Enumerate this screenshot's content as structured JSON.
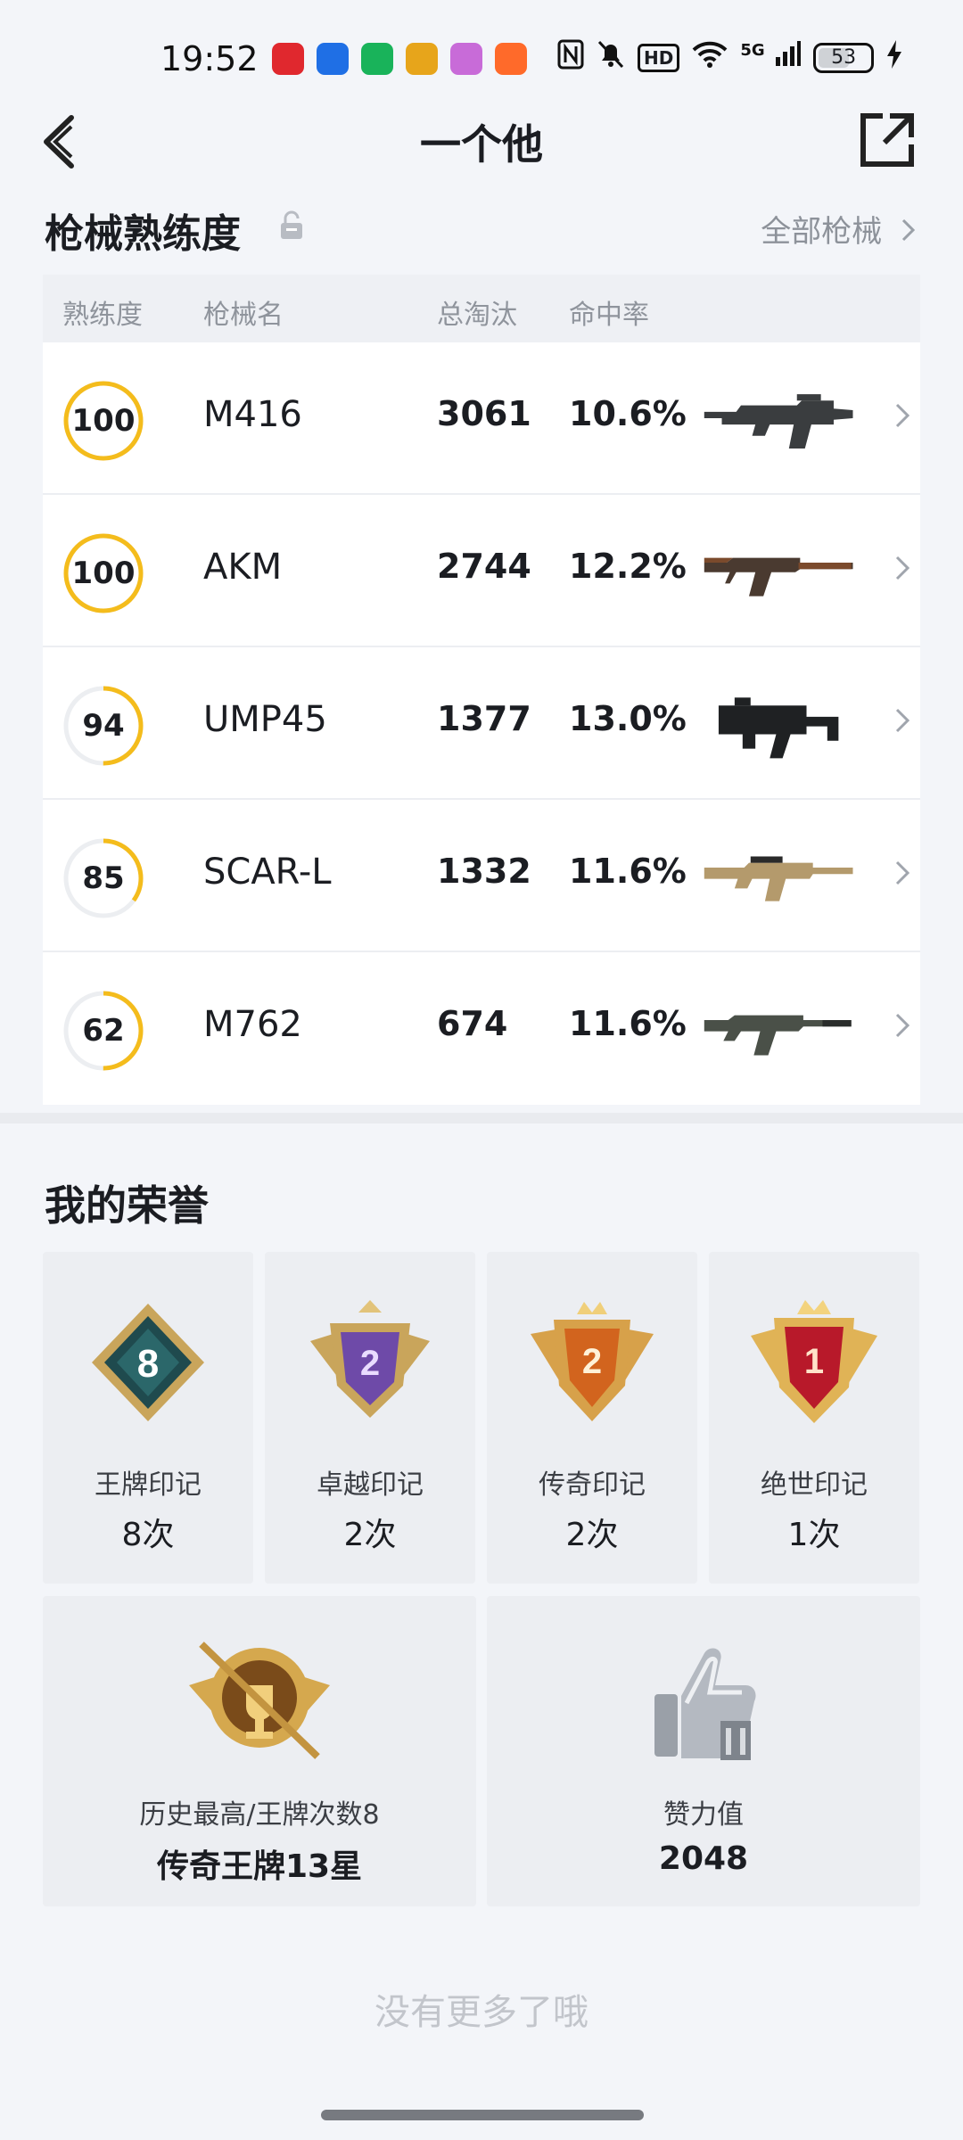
{
  "status_bar": {
    "time": "19:52",
    "battery": "53",
    "hd": "HD",
    "network": "5G",
    "app_icons": [
      "music-app-icon",
      "shield-app-icon",
      "security-app-icon",
      "game-news-app-icon",
      "gallery-app-icon",
      "game-center-app-icon"
    ],
    "app_colors": [
      "#e0282e",
      "#1f6fe5",
      "#19b35a",
      "#e7a51b",
      "#c86bd8",
      "#ff6a2a"
    ]
  },
  "header": {
    "title": "一个他"
  },
  "weapons": {
    "title": "枪械熟练度",
    "all_link": "全部枪械",
    "columns": [
      "熟练度",
      "枪械名",
      "总淘汰",
      "命中率"
    ],
    "rows": [
      {
        "proficiency": "100",
        "level": 1.0,
        "name": "M416",
        "kills": "3061",
        "hit_rate": "10.6%"
      },
      {
        "proficiency": "100",
        "level": 1.0,
        "name": "AKM",
        "kills": "2744",
        "hit_rate": "12.2%"
      },
      {
        "proficiency": "94",
        "level": 0.5,
        "name": "UMP45",
        "kills": "1377",
        "hit_rate": "13.0%"
      },
      {
        "proficiency": "85",
        "level": 0.35,
        "name": "SCAR-L",
        "kills": "1332",
        "hit_rate": "11.6%"
      },
      {
        "proficiency": "62",
        "level": 0.5,
        "name": "M762",
        "kills": "674",
        "hit_rate": "11.6%"
      }
    ],
    "ring_color": "#f4bc1c"
  },
  "honors": {
    "title": "我的荣誉",
    "badges": [
      {
        "label": "王牌印记",
        "count": "8次",
        "num": "8"
      },
      {
        "label": "卓越印记",
        "count": "2次",
        "num": "2"
      },
      {
        "label": "传奇印记",
        "count": "2次",
        "num": "2"
      },
      {
        "label": "绝世印记",
        "count": "1次",
        "num": "1"
      }
    ],
    "highest": {
      "label": "历史最高/王牌次数8",
      "value": "传奇王牌13星"
    },
    "likes": {
      "label": "赞力值",
      "value": "2048"
    }
  },
  "footer": {
    "no_more": "没有更多了哦"
  }
}
